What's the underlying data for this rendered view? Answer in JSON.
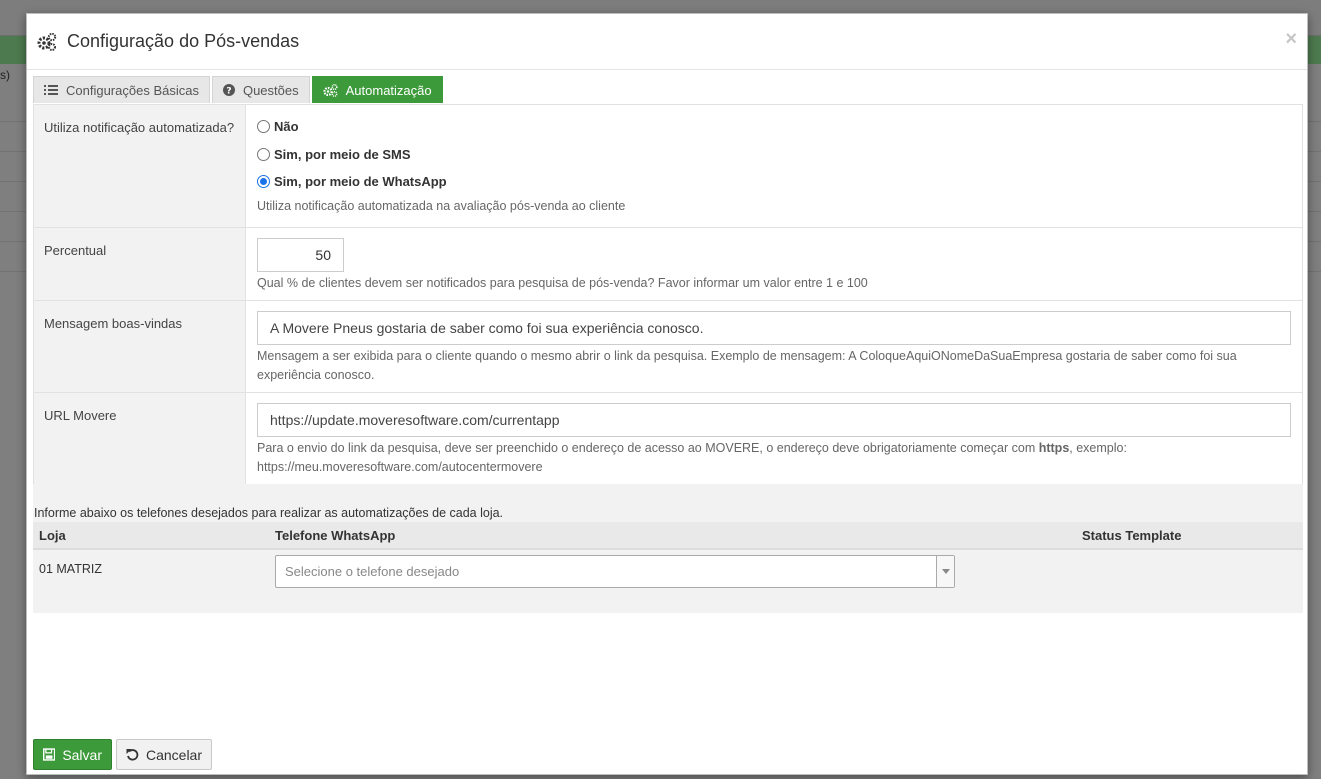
{
  "background": {
    "edge_text": "s)"
  },
  "modal": {
    "title": "Configuração do Pós-vendas",
    "close_label": "×"
  },
  "tabs": [
    {
      "label": "Configurações Básicas",
      "icon": "list-icon",
      "active": false
    },
    {
      "label": "Questões",
      "icon": "question-circle-icon",
      "active": false
    },
    {
      "label": "Automatização",
      "icon": "gears-icon",
      "active": true
    }
  ],
  "form": {
    "notification": {
      "label": "Utiliza notificação automatizada?",
      "options": [
        {
          "label": "Não",
          "checked": false
        },
        {
          "label": "Sim, por meio de SMS",
          "checked": false
        },
        {
          "label": "Sim, por meio de WhatsApp",
          "checked": true
        }
      ],
      "help": "Utiliza notificação automatizada na avaliação pós-venda ao cliente"
    },
    "percentual": {
      "label": "Percentual",
      "value": "50",
      "help": "Qual % de clientes devem ser notificados para pesquisa de pós-venda? Favor informar um valor entre 1 e 100"
    },
    "welcome": {
      "label": "Mensagem boas-vindas",
      "value": "A Movere Pneus gostaria de saber como foi sua experiência conosco.",
      "help": "Mensagem a ser exibida para o cliente quando o mesmo abrir o link da pesquisa. Exemplo de mensagem: A ColoqueAquiONomeDaSuaEmpresa gostaria de saber como foi sua experiência conosco."
    },
    "url": {
      "label": "URL Movere",
      "value": "https://update.moveresoftware.com/currentapp",
      "help_before": "Para o envio do link da pesquisa, deve ser preenchido o endereço de acesso ao MOVERE, o endereço deve obrigatoriamente começar com ",
      "help_bold": "https",
      "help_after": ", exemplo: https://meu.moveresoftware.com/autocentermovere"
    }
  },
  "stores": {
    "info": "Informe abaixo os telefones desejados para realizar as automatizações de cada loja.",
    "columns": {
      "loja": "Loja",
      "phone": "Telefone WhatsApp",
      "status": "Status Template"
    },
    "rows": [
      {
        "loja": "01 MATRIZ",
        "placeholder": "Selecione o telefone desejado",
        "status": ""
      }
    ]
  },
  "buttons": {
    "save": "Salvar",
    "cancel": "Cancelar"
  },
  "colors": {
    "primary_green": "#3c9a3a",
    "radio_blue": "#1a73e8"
  }
}
